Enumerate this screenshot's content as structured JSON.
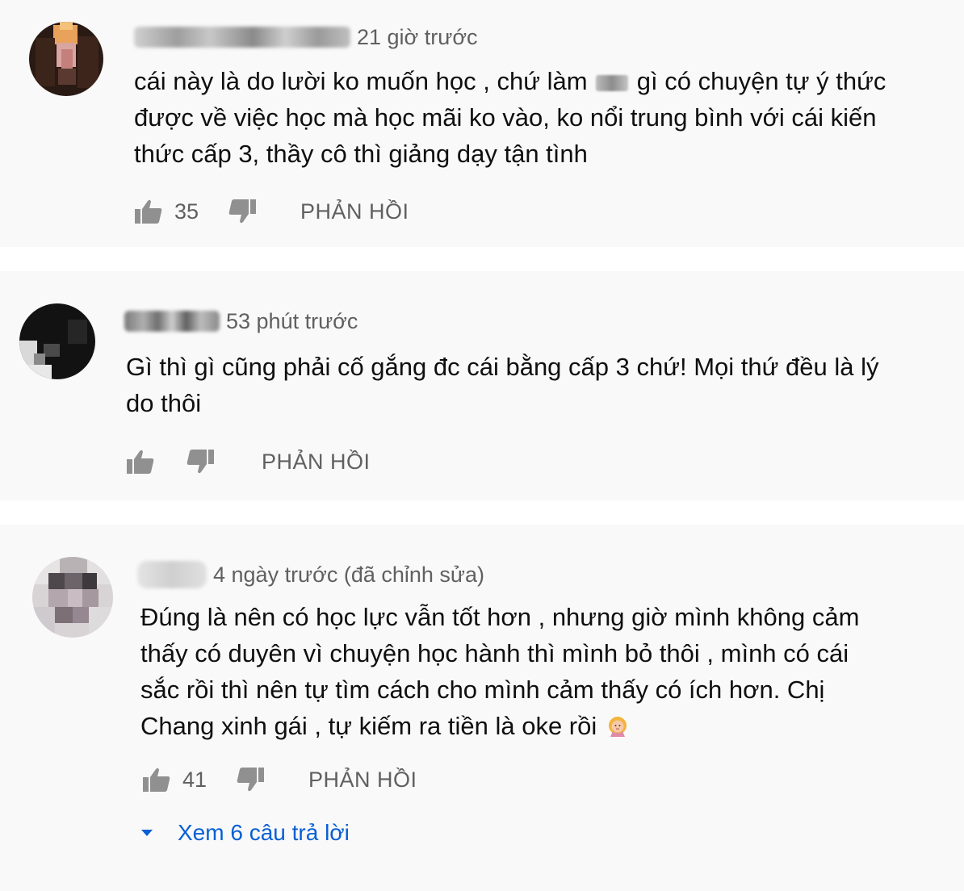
{
  "comments": [
    {
      "timestamp": "21 giờ trước",
      "text_before": "cái này là do lười ko muốn học , chứ làm",
      "text_after": "gì có chuyện tự ý thức được về việc học mà học mãi ko vào, ko nổi trung bình với cái kiến thức cấp 3, thầy cô thì giảng dạy tận tình",
      "likes": "35",
      "reply_label": "PHẢN HỒI",
      "avatar_icon": "pixelated-avatar"
    },
    {
      "timestamp": "53 phút trước",
      "text": "Gì thì gì cũng phải cố gắng đc cái bằng cấp 3 chứ! Mọi thứ đều là lý do thôi",
      "likes": "",
      "reply_label": "PHẢN HỒI",
      "avatar_icon": "pixelated-avatar"
    },
    {
      "timestamp": "4 ngày trước (đã chỉnh sửa)",
      "text": "Đúng là nên có học lực vẫn tốt hơn , nhưng giờ mình không cảm thấy có duyên vì chuyện học hành thì mình bỏ thôi , mình có cái sắc rồi thì nên tự tìm cách cho mình cảm thấy có ích hơn. Chị Chang xinh gái , tự kiếm ra tiền là oke rồi",
      "emoji_icon": "person-gesturing-no-emoji",
      "likes": "41",
      "reply_label": "PHẢN HỒI",
      "avatar_icon": "pixelated-avatar"
    }
  ],
  "view_replies": {
    "label": "Xem 6 câu trả lời",
    "icon": "caret-down-icon"
  },
  "colors": {
    "panel_bg": "#f9f9f9",
    "text": "#0f0f0f",
    "meta": "#606060",
    "link": "#065fd4"
  }
}
